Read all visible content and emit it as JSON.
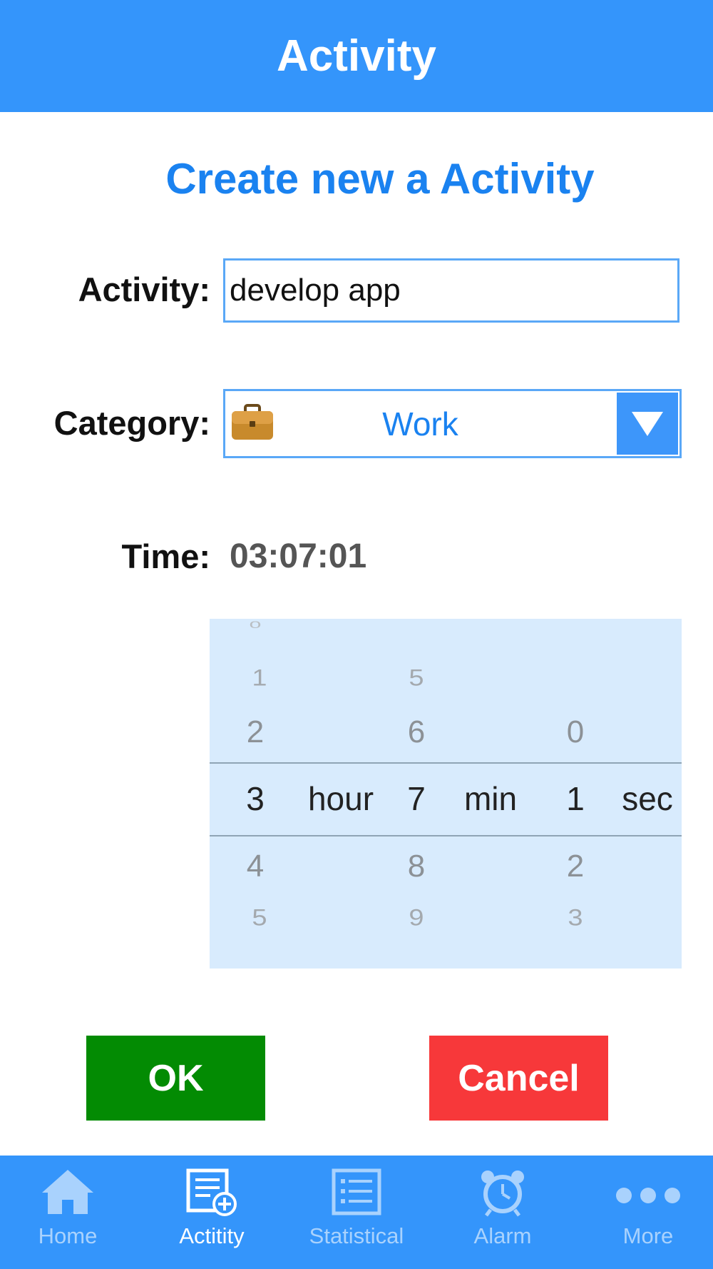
{
  "header": {
    "title": "Activity"
  },
  "form": {
    "heading": "Create new a Activity",
    "activity_label": "Activity:",
    "activity_value": "develop app",
    "category_label": "Category:",
    "category_value": "Work",
    "category_icon": "briefcase-icon",
    "time_label": "Time:",
    "time_value": "03:07:01"
  },
  "picker": {
    "hour_unit": "hour",
    "min_unit": "min",
    "sec_unit": "sec",
    "hours": {
      "above2": "1",
      "above1": "2",
      "selected": "3",
      "below1": "4",
      "below2": "5"
    },
    "minutes": {
      "above2": "5",
      "above1": "6",
      "selected": "7",
      "below1": "8",
      "below2": "9"
    },
    "seconds": {
      "above1": "0",
      "selected": "1",
      "below1": "2",
      "below2": "3"
    }
  },
  "buttons": {
    "ok": "OK",
    "cancel": "Cancel"
  },
  "tabbar": {
    "active_color": "#ffffff",
    "inactive_color": "#a9d2fd",
    "items": [
      {
        "label": "Home",
        "icon": "home-icon"
      },
      {
        "label": "Actitity",
        "icon": "add-document-icon",
        "active": true
      },
      {
        "label": "Statistical",
        "icon": "list-icon"
      },
      {
        "label": "Alarm",
        "icon": "alarm-clock-icon"
      },
      {
        "label": "More",
        "icon": "more-dots-icon"
      }
    ]
  },
  "colors": {
    "brand": "#3495fb",
    "heading": "#1a82f0",
    "ok": "#038b03",
    "cancel": "#f7383a",
    "picker_bg": "#d8ebfd"
  }
}
